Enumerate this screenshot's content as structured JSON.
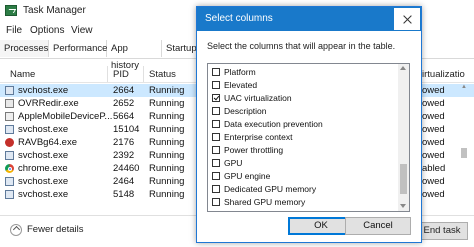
{
  "window": {
    "title": "Task Manager"
  },
  "menu": [
    "File",
    "Options",
    "View"
  ],
  "tabs": [
    "Processes",
    "Performance",
    "App history",
    "Startup"
  ],
  "columns": {
    "name": "Name",
    "pid": "PID",
    "status": "Status",
    "uac_partial": "irtualizatio"
  },
  "rows": [
    {
      "name": "svchost.exe",
      "pid": "2664",
      "status": "Running",
      "uac": "owed",
      "icon": "svchost-icon",
      "selected": true
    },
    {
      "name": "OVRRedir.exe",
      "pid": "2652",
      "status": "Running",
      "uac": "owed",
      "icon": "app-icon"
    },
    {
      "name": "AppleMobileDeviceP...",
      "pid": "5664",
      "status": "Running",
      "uac": "owed",
      "icon": "app-icon"
    },
    {
      "name": "svchost.exe",
      "pid": "15104",
      "status": "Running",
      "uac": "owed",
      "icon": "svchost-icon"
    },
    {
      "name": "RAVBg64.exe",
      "pid": "2176",
      "status": "Running",
      "uac": "owed",
      "icon": "ravbg-icon"
    },
    {
      "name": "svchost.exe",
      "pid": "2392",
      "status": "Running",
      "uac": "owed",
      "icon": "svchost-icon"
    },
    {
      "name": "chrome.exe",
      "pid": "24460",
      "status": "Running",
      "uac": "abled",
      "icon": "chrome-icon"
    },
    {
      "name": "svchost.exe",
      "pid": "2464",
      "status": "Running",
      "uac": "owed",
      "icon": "svchost-icon"
    },
    {
      "name": "svchost.exe",
      "pid": "5148",
      "status": "Running",
      "uac": "owed",
      "icon": "svchost-icon"
    }
  ],
  "footer": {
    "fewer_details": "Fewer details",
    "end_task": "End task"
  },
  "dialog": {
    "title": "Select columns",
    "instruction": "Select the columns that will appear in the table.",
    "items": [
      {
        "label": "Platform",
        "checked": false
      },
      {
        "label": "Elevated",
        "checked": false
      },
      {
        "label": "UAC virtualization",
        "checked": true
      },
      {
        "label": "Description",
        "checked": false
      },
      {
        "label": "Data execution prevention",
        "checked": false
      },
      {
        "label": "Enterprise context",
        "checked": false
      },
      {
        "label": "Power throttling",
        "checked": false
      },
      {
        "label": "GPU",
        "checked": false
      },
      {
        "label": "GPU engine",
        "checked": false
      },
      {
        "label": "Dedicated GPU memory",
        "checked": false
      },
      {
        "label": "Shared GPU memory",
        "checked": false
      }
    ],
    "ok": "OK",
    "cancel": "Cancel"
  },
  "colors": {
    "accent": "#1979ca",
    "selected_row": "#cce8ff"
  }
}
